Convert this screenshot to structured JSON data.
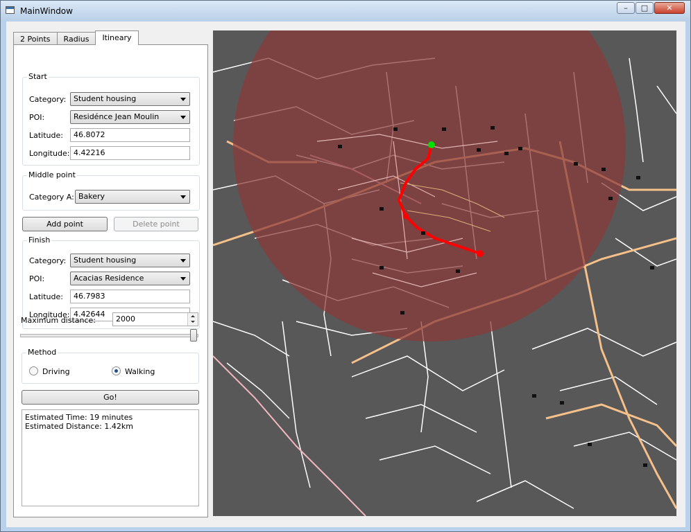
{
  "window": {
    "title": "MainWindow",
    "buttons": {
      "minimize": "–",
      "maximize": "□",
      "close": "✕"
    }
  },
  "tabs": [
    {
      "label": "2 Points",
      "active": false
    },
    {
      "label": "Radius",
      "active": false
    },
    {
      "label": "Itineary",
      "active": true
    }
  ],
  "start": {
    "title": "Start",
    "category_label": "Category:",
    "category_value": "Student housing",
    "poi_label": "POI:",
    "poi_value": "Residénce Jean Moulin",
    "lat_label": "Latitude:",
    "lat_value": "46.8072",
    "lon_label": "Longitude:",
    "lon_value": "4.42216"
  },
  "middle": {
    "title": "Middle point",
    "category_label": "Category A:",
    "category_value": "Bakery"
  },
  "buttons": {
    "add_point": "Add point",
    "delete_point": "Delete point",
    "go": "Go!"
  },
  "finish": {
    "title": "Finish",
    "category_label": "Category:",
    "category_value": "Student housing",
    "poi_label": "POI:",
    "poi_value": "Acacias Residence",
    "lat_label": "Latitude:",
    "lat_value": "46.7983",
    "lon_label": "Longitude:",
    "lon_value": "4.42644"
  },
  "max_distance": {
    "label": "Maximum distance:",
    "value": "2000",
    "slider_level": 1.0
  },
  "method": {
    "title": "Method",
    "driving": "Driving",
    "walking": "Walking",
    "selected": "Walking"
  },
  "output": {
    "time": "Estimated Time: 19 minutes",
    "distance": "Estimated Distance: 1.42km"
  },
  "colors": {
    "map_background": "#585858",
    "radius_overlay": "#8b3a3a",
    "route": "#ff0000",
    "start_marker": "#00e000",
    "roads_minor": "#ffffff",
    "roads_major": "#f5c08a",
    "roads_pink": "#f4b6c0"
  }
}
